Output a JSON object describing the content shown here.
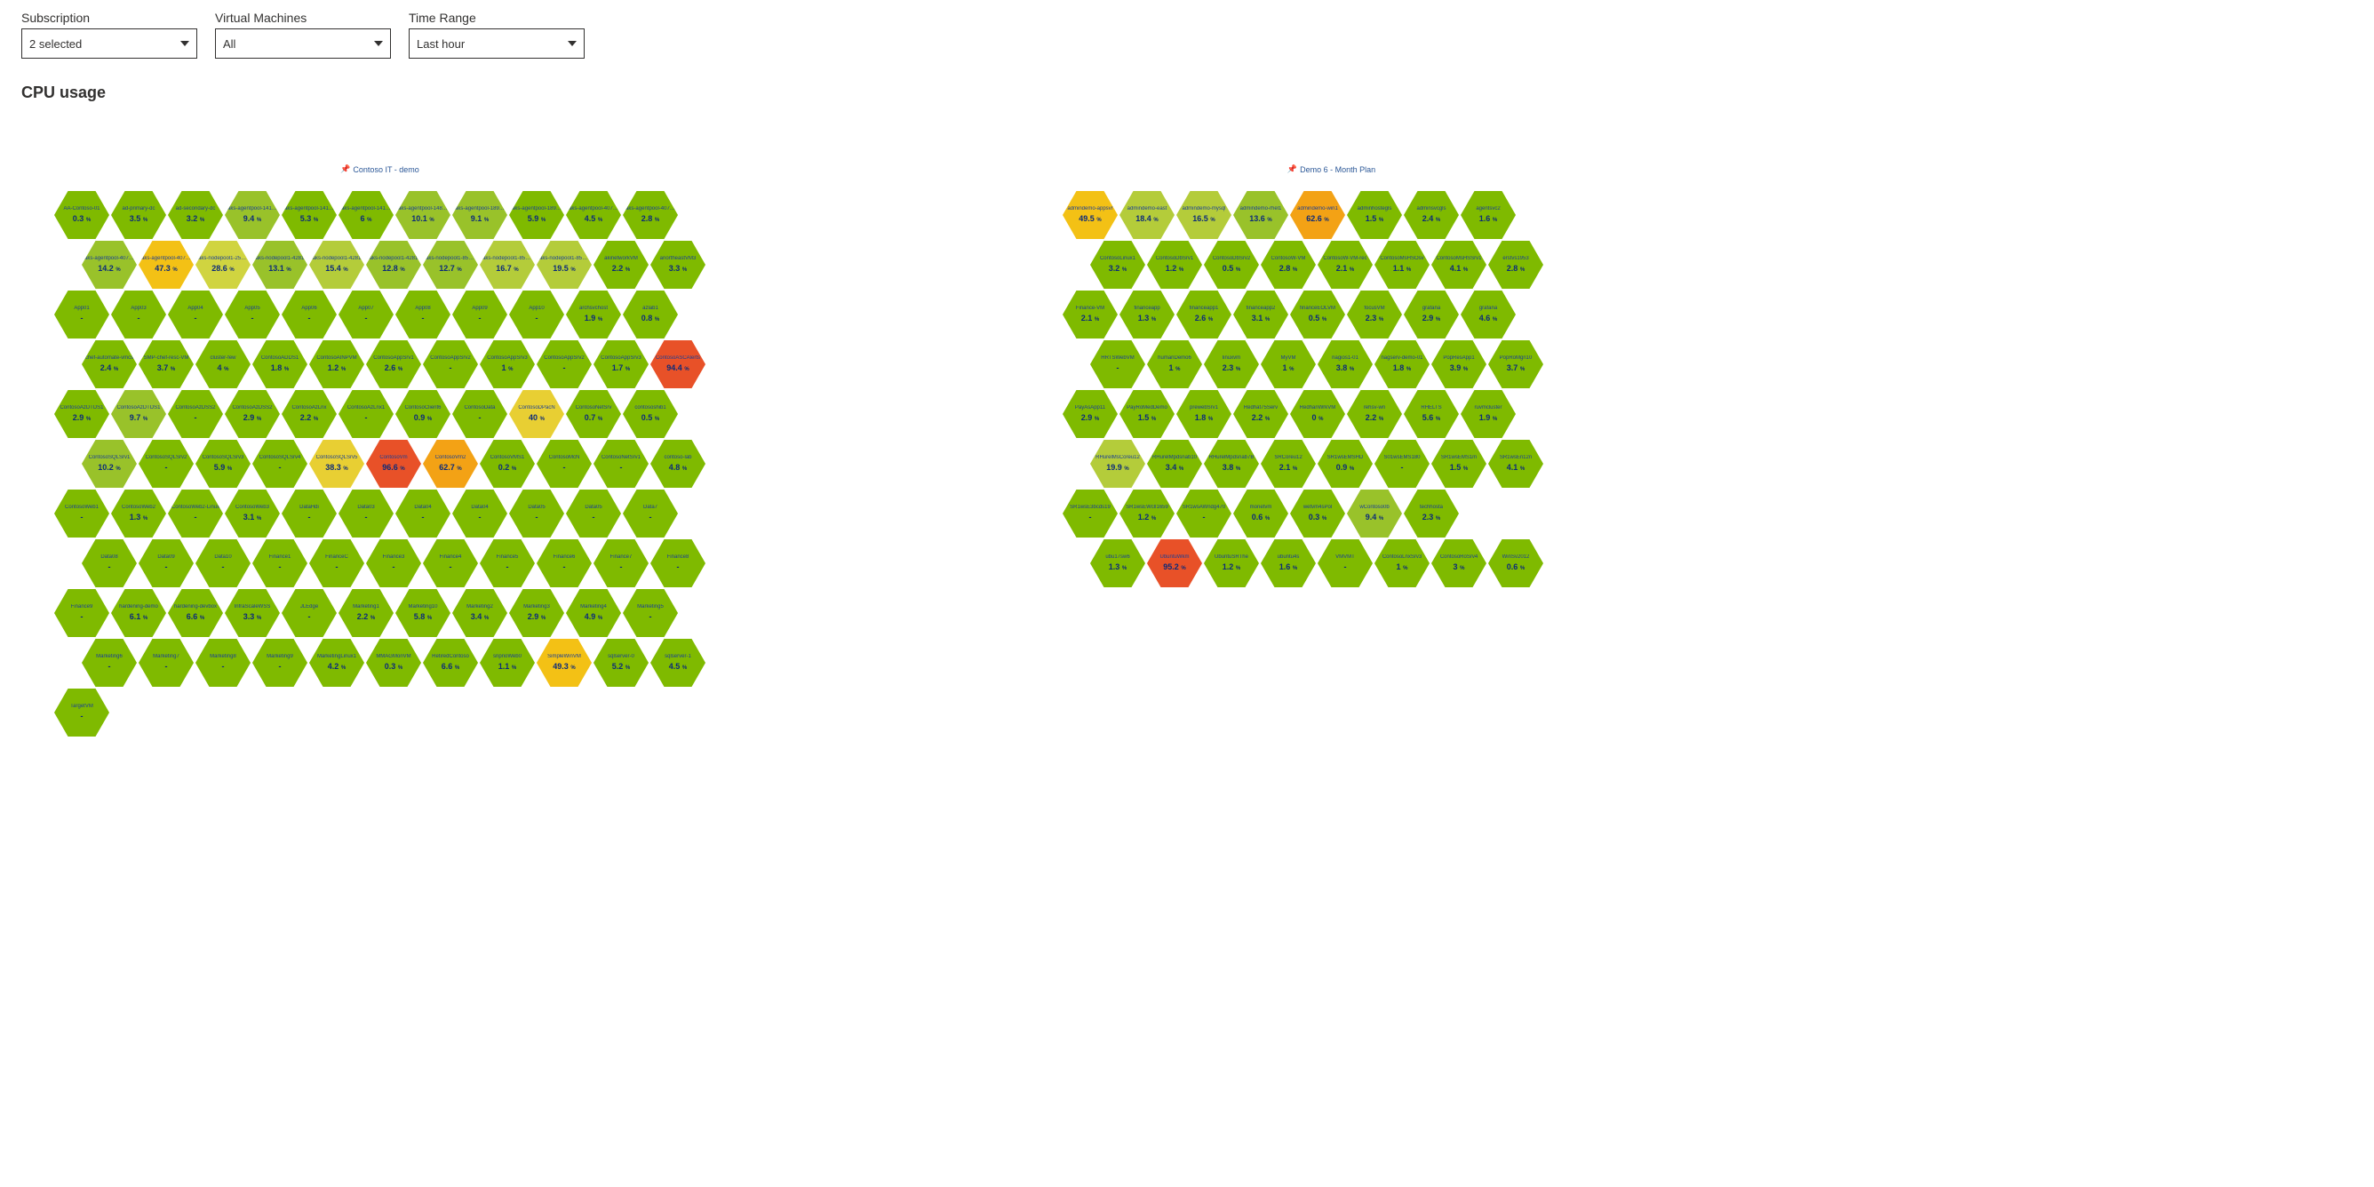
{
  "filters": {
    "subscription": {
      "label": "Subscription",
      "value": "2 selected"
    },
    "vms": {
      "label": "Virtual Machines",
      "value": "All"
    },
    "timerange": {
      "label": "Time Range",
      "value": "Last hour"
    }
  },
  "section_title": "CPU usage",
  "chart_data": {
    "type": "heatmap",
    "metric": "CPU usage %",
    "unit": "%",
    "color_scale": {
      "min": 0,
      "max": 100,
      "low_color": "#7fba00",
      "high_color": "#e85128"
    },
    "clusters": [
      {
        "title": "Contoso IT - demo",
        "columns": 11,
        "cells": [
          {
            "name": "AA-Contoso-01",
            "value": 0.3
          },
          {
            "name": "ad-primary-dc",
            "value": 3.5
          },
          {
            "name": "ad-secondary-dc",
            "value": 3.2
          },
          {
            "name": "aks-agentpool-14127",
            "value": 9.4
          },
          {
            "name": "aks-agentpool-14127",
            "value": 5.3
          },
          {
            "name": "aks-agentpool-14127",
            "value": 6.0
          },
          {
            "name": "aks-agentpool-14820",
            "value": 10.1
          },
          {
            "name": "aks-agentpool-18940",
            "value": 9.1
          },
          {
            "name": "aks-agentpool-18940",
            "value": 5.9
          },
          {
            "name": "aks-agentpool-40719",
            "value": 4.5
          },
          {
            "name": "aks-agentpool-40719",
            "value": 2.8
          },
          {
            "name": "aks-agentpool-40719",
            "value": 14.2
          },
          {
            "name": "aks-agentpool-40719",
            "value": 47.3
          },
          {
            "name": "aks-nodepool1-25496",
            "value": 28.6
          },
          {
            "name": "aks-nodepool1-4281",
            "value": 13.1
          },
          {
            "name": "aks-nodepool1-4281",
            "value": 15.4
          },
          {
            "name": "aks-nodepool1-4281",
            "value": 12.8
          },
          {
            "name": "aks-nodepool1-85306",
            "value": 12.7
          },
          {
            "name": "aks-nodepool1-85306",
            "value": 16.7
          },
          {
            "name": "aks-nodepool1-85306",
            "value": 19.5
          },
          {
            "name": "akinetworkVM",
            "value": 2.2
          },
          {
            "name": "anortheastVM3",
            "value": 3.3
          },
          {
            "name": "App01",
            "value": null
          },
          {
            "name": "App03",
            "value": null
          },
          {
            "name": "App04",
            "value": null
          },
          {
            "name": "App05",
            "value": null
          },
          {
            "name": "App06",
            "value": null
          },
          {
            "name": "App07",
            "value": null
          },
          {
            "name": "App08",
            "value": null
          },
          {
            "name": "App09",
            "value": null
          },
          {
            "name": "App10",
            "value": null
          },
          {
            "name": "archsvchost",
            "value": 1.9
          },
          {
            "name": "azlab1",
            "value": 0.8
          },
          {
            "name": "chef-automate-vmcs",
            "value": 2.4
          },
          {
            "name": "SMP-chef-resc-VM",
            "value": 3.7
          },
          {
            "name": "cluster-few",
            "value": 4.0
          },
          {
            "name": "ContosoADDS1",
            "value": 1.8
          },
          {
            "name": "ContosoAINPVM",
            "value": 1.2
          },
          {
            "name": "ContosoAppSrv1",
            "value": 2.6
          },
          {
            "name": "ContosoAppSrv2",
            "value": null
          },
          {
            "name": "ContosoAppSrv3",
            "value": 1.0
          },
          {
            "name": "ContosoAppSrv2",
            "value": null
          },
          {
            "name": "ContosoAppSrv3",
            "value": 1.7
          },
          {
            "name": "ContosoASCAlerts",
            "value": 94.4
          },
          {
            "name": "ContosoAzDTDS1",
            "value": 2.9
          },
          {
            "name": "ContosoAzDTDS1",
            "value": 9.7
          },
          {
            "name": "ContosoAzDSS2",
            "value": null
          },
          {
            "name": "ContosoAzDSS2",
            "value": 2.9
          },
          {
            "name": "ContosoAzLnx",
            "value": 2.2
          },
          {
            "name": "ContosoAzLnx1",
            "value": null
          },
          {
            "name": "ContosoClient6",
            "value": 0.9
          },
          {
            "name": "ContosoData",
            "value": null
          },
          {
            "name": "ContosoDPacN",
            "value": 40.0
          },
          {
            "name": "ContosoNetSrv",
            "value": 0.7
          },
          {
            "name": "contososhib1",
            "value": 0.5
          },
          {
            "name": "ContosoSQLSrv1",
            "value": 10.2
          },
          {
            "name": "ContosoSQLSrv2",
            "value": null
          },
          {
            "name": "ContosoSQLSrv3",
            "value": 5.9
          },
          {
            "name": "ContosoSQLSrv4",
            "value": null
          },
          {
            "name": "ContosoSQLSrv5",
            "value": 38.3
          },
          {
            "name": "ContosoVm",
            "value": 96.6
          },
          {
            "name": "ContosoVm2",
            "value": 62.7
          },
          {
            "name": "ContosoVMS1",
            "value": 0.2
          },
          {
            "name": "ContosoMcN",
            "value": null
          },
          {
            "name": "ContosoNetSrv1",
            "value": null
          },
          {
            "name": "contoso-lab",
            "value": 4.8
          },
          {
            "name": "ContosoWeb1",
            "value": null
          },
          {
            "name": "ContosoWeb2",
            "value": 1.3
          },
          {
            "name": "ContosoWeb2-Linux",
            "value": null
          },
          {
            "name": "ContosoWeb3",
            "value": 3.1
          },
          {
            "name": "DataHdi",
            "value": null
          },
          {
            "name": "Data03",
            "value": null
          },
          {
            "name": "Data04",
            "value": null
          },
          {
            "name": "Data04",
            "value": null
          },
          {
            "name": "Data05",
            "value": null
          },
          {
            "name": "Data05",
            "value": null
          },
          {
            "name": "Data7",
            "value": null
          },
          {
            "name": "Data08",
            "value": null
          },
          {
            "name": "Data09",
            "value": null
          },
          {
            "name": "Data10",
            "value": null
          },
          {
            "name": "Finance1",
            "value": null
          },
          {
            "name": "FinanceC",
            "value": null
          },
          {
            "name": "Finance3",
            "value": null
          },
          {
            "name": "Finance4",
            "value": null
          },
          {
            "name": "Finance5",
            "value": null
          },
          {
            "name": "Finance6",
            "value": null
          },
          {
            "name": "Finance7",
            "value": null
          },
          {
            "name": "Finance8",
            "value": null
          },
          {
            "name": "Finance9",
            "value": null
          },
          {
            "name": "hardening-demo",
            "value": 6.1
          },
          {
            "name": "hardening-devbox",
            "value": 6.6
          },
          {
            "name": "InfraScaleWSS",
            "value": 3.3
          },
          {
            "name": "JLEdge",
            "value": null
          },
          {
            "name": "Marketing1",
            "value": 2.2
          },
          {
            "name": "Marketing10",
            "value": 5.8
          },
          {
            "name": "Marketing2",
            "value": 3.4
          },
          {
            "name": "Marketing3",
            "value": 2.9
          },
          {
            "name": "Marketing4",
            "value": 4.9
          },
          {
            "name": "Marketing5",
            "value": null
          },
          {
            "name": "Marketing6",
            "value": null
          },
          {
            "name": "Marketing7",
            "value": null
          },
          {
            "name": "Marketing8",
            "value": null
          },
          {
            "name": "Marketing9",
            "value": null
          },
          {
            "name": "MarketingLinux1",
            "value": 4.2
          },
          {
            "name": "MMAGMonVM",
            "value": 0.3
          },
          {
            "name": "RetiredContoso",
            "value": 6.6
          },
          {
            "name": "sriprioWeb0",
            "value": 1.1
          },
          {
            "name": "SimpleWinVM",
            "value": 49.3
          },
          {
            "name": "sqlserver-0",
            "value": 5.2
          },
          {
            "name": "sqlserver-1",
            "value": 4.5
          },
          {
            "name": "TargetVM",
            "value": null
          }
        ]
      },
      {
        "title": "Demo 6 - Month Plan",
        "columns": 9,
        "leading_empty_on_last_row": 0,
        "cells": [
          {
            "name": "admindemo-appsvr",
            "value": 49.5
          },
          {
            "name": "admindemo-east",
            "value": 18.4
          },
          {
            "name": "admindemo-mysql",
            "value": 16.5
          },
          {
            "name": "admindemo-rhel1",
            "value": 13.6
          },
          {
            "name": "admindemo-win1",
            "value": 62.6
          },
          {
            "name": "adminhostegls",
            "value": 1.5
          },
          {
            "name": "adminsvcgls",
            "value": 2.4
          },
          {
            "name": "agentsvc2",
            "value": 1.6
          },
          {
            "empty": true
          },
          {
            "name": "ContosoLinux1",
            "value": 3.2
          },
          {
            "name": "ContosoDbSrv1",
            "value": 1.2
          },
          {
            "name": "ContosoDbSrv2",
            "value": 0.5
          },
          {
            "name": "ContosoW-VM",
            "value": 2.8
          },
          {
            "name": "ContosoW-VM-rec",
            "value": 2.1
          },
          {
            "name": "ContosoMsHSOsv",
            "value": 1.1
          },
          {
            "name": "ContosoMsHSSrv1",
            "value": 4.1
          },
          {
            "name": "erstvs1953",
            "value": 2.8
          },
          {
            "empty": true
          },
          {
            "name": "Finance-VM",
            "value": 2.1
          },
          {
            "name": "financeapp",
            "value": 1.3
          },
          {
            "name": "financeapp1",
            "value": 2.6
          },
          {
            "name": "financeapp2",
            "value": 3.1
          },
          {
            "name": "financeEOLVM",
            "value": 0.5
          },
          {
            "name": "focusVM",
            "value": 2.3
          },
          {
            "name": "grafana",
            "value": 2.9
          },
          {
            "name": "grafana",
            "value": 4.6
          },
          {
            "empty": true
          },
          {
            "name": "HRTSWebVM",
            "value": null
          },
          {
            "name": "humanDemo6",
            "value": 1.0
          },
          {
            "name": "linuxvm",
            "value": 2.3
          },
          {
            "name": "MyVM",
            "value": 1.0
          },
          {
            "name": "nagios1-01",
            "value": 3.8
          },
          {
            "name": "nagserv-demo-01",
            "value": 1.8
          },
          {
            "name": "PopResApp1",
            "value": 3.9
          },
          {
            "name": "PopRoMgn10",
            "value": 3.7
          },
          {
            "empty": true
          },
          {
            "name": "PayAsApp11",
            "value": 2.9
          },
          {
            "name": "PayRoMedDemo",
            "value": 1.5
          },
          {
            "name": "prewebSrv1",
            "value": 1.8
          },
          {
            "name": "Redhat75Serv",
            "value": 2.2
          },
          {
            "name": "RedhanWrkVM",
            "value": 0.0
          },
          {
            "name": "rehsv-wn",
            "value": 2.2
          },
          {
            "name": "RHELTS",
            "value": 5.6
          },
          {
            "name": "ruvmcluster",
            "value": 1.9
          },
          {
            "empty": true
          },
          {
            "name": "RHurelMsCoreu12",
            "value": 19.9
          },
          {
            "name": "RHurelMpdsnab10",
            "value": 3.4
          },
          {
            "name": "RHurelMpdsnab7B",
            "value": 3.8
          },
          {
            "name": "SRCoreu12",
            "value": 2.1
          },
          {
            "name": "SR1wsEMSHD",
            "value": 0.9
          },
          {
            "name": "S01wsEMS180",
            "value": null
          },
          {
            "name": "SR1wsEMS1m",
            "value": 1.5
          },
          {
            "name": "SR1wsEn12n",
            "value": 4.1
          },
          {
            "empty": true
          },
          {
            "name": "SR1wsE3bcds19",
            "value": null
          },
          {
            "name": "SR1wsEWcll1659",
            "value": 1.2
          },
          {
            "name": "SR1wsAWndg470",
            "value": null
          },
          {
            "name": "monetvm",
            "value": 0.6
          },
          {
            "name": "wetvm4sPol",
            "value": 0.3
          },
          {
            "name": "wContoso0b",
            "value": 9.4
          },
          {
            "name": "techhosta",
            "value": 2.3
          },
          {
            "empty": true
          },
          {
            "empty": true
          },
          {
            "name": "ubu17sw6",
            "value": 1.3
          },
          {
            "name": "UbuntuWkm",
            "value": 95.2
          },
          {
            "name": "UbuntuSRThe",
            "value": 1.2
          },
          {
            "name": "ubuntu4s",
            "value": 1.6
          },
          {
            "name": "VMVMT",
            "value": null
          },
          {
            "name": "ContosoLnxSrv3",
            "value": 1.0
          },
          {
            "name": "ContosoRoSrv4",
            "value": 3.0
          },
          {
            "name": "WinSv2012",
            "value": 0.6
          },
          {
            "empty": true
          }
        ]
      }
    ]
  }
}
